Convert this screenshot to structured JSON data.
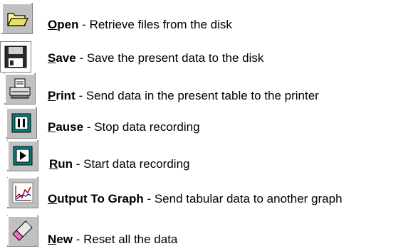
{
  "items": [
    {
      "icon": "open-folder-icon",
      "hotkey": "O",
      "rest": "pen",
      "desc": " - Retrieve files from the disk"
    },
    {
      "icon": "save-disk-icon",
      "hotkey": "S",
      "rest": "ave",
      "desc": " - Save the present data to the disk"
    },
    {
      "icon": "printer-icon",
      "hotkey": "P",
      "rest": "rint",
      "desc": " - Send data in the present table to the printer"
    },
    {
      "icon": "pause-icon",
      "hotkey": "P",
      "rest": "ause",
      "desc": " - Stop data recording"
    },
    {
      "icon": "run-play-icon",
      "hotkey": "R",
      "rest": "un",
      "desc": " - Start data recording"
    },
    {
      "icon": "graph-icon",
      "hotkey": "O",
      "rest": "utput To Graph",
      "desc": " - Send tabular data to another graph"
    },
    {
      "icon": "eraser-icon",
      "hotkey": "N",
      "rest": "ew",
      "desc": " - Reset all the data"
    }
  ]
}
